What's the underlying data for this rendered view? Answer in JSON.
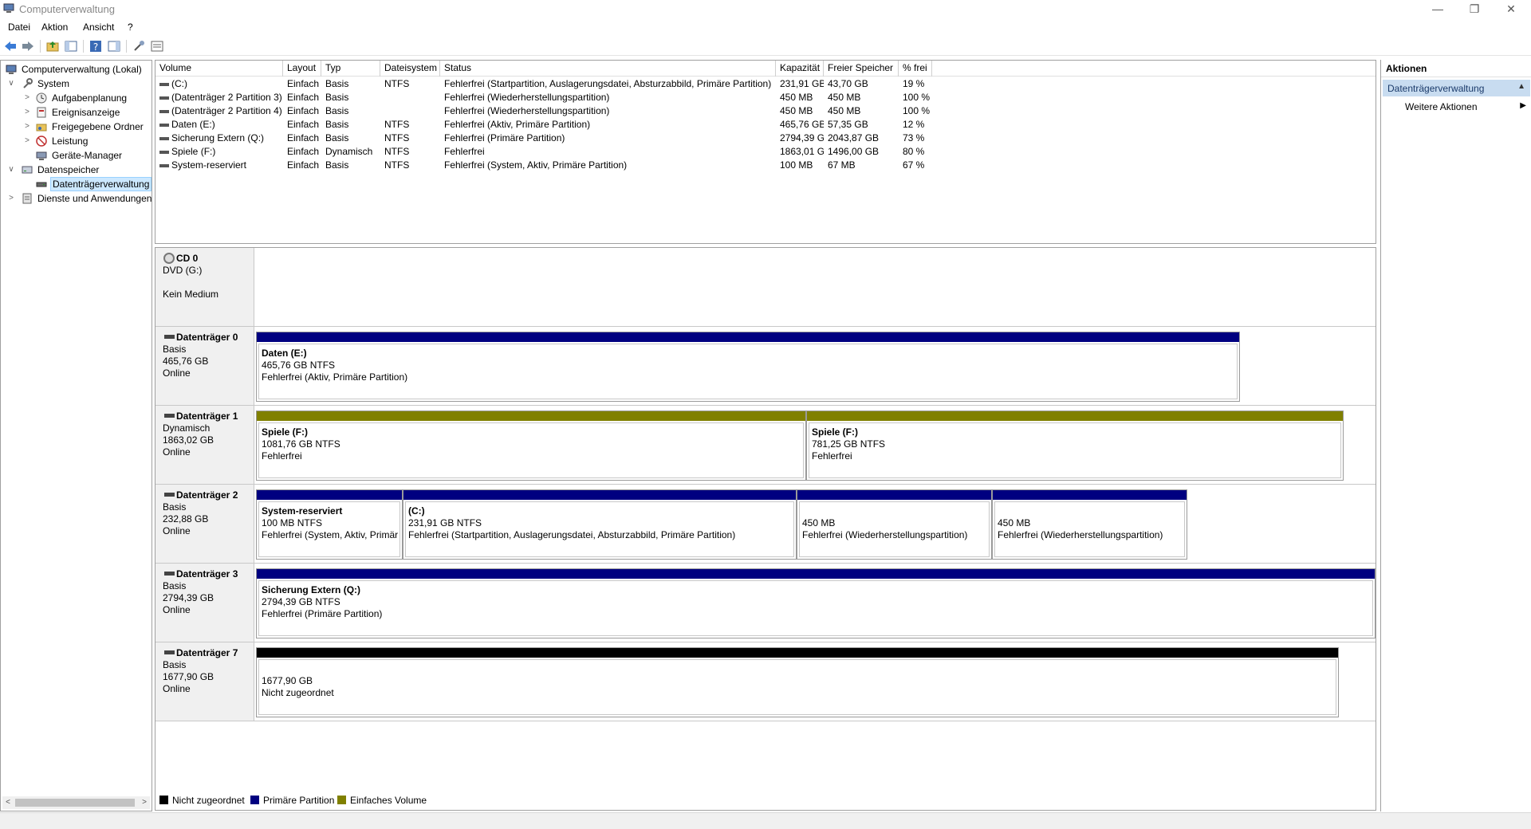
{
  "window": {
    "title": "Computerverwaltung"
  },
  "menu": {
    "items": [
      "Datei",
      "Aktion",
      "Ansicht",
      "?"
    ]
  },
  "tree": {
    "items": [
      {
        "label": "Computerverwaltung (Lokal)",
        "level": 0,
        "expander": "",
        "icon": "computer-management-icon"
      },
      {
        "label": "System",
        "level": 0,
        "expander": "v",
        "icon": "system-tools-icon"
      },
      {
        "label": "Aufgabenplanung",
        "level": 1,
        "expander": ">",
        "icon": "task-scheduler-icon"
      },
      {
        "label": "Ereignisanzeige",
        "level": 1,
        "expander": ">",
        "icon": "event-viewer-icon"
      },
      {
        "label": "Freigegebene Ordner",
        "level": 1,
        "expander": ">",
        "icon": "shared-folders-icon"
      },
      {
        "label": "Leistung",
        "level": 1,
        "expander": ">",
        "icon": "performance-icon"
      },
      {
        "label": "Geräte-Manager",
        "level": 1,
        "expander": "",
        "icon": "device-manager-icon"
      },
      {
        "label": "Datenspeicher",
        "level": 0,
        "expander": "v",
        "icon": "storage-icon"
      },
      {
        "label": "Datenträgerverwaltung",
        "level": 1,
        "expander": "",
        "icon": "disk-management-icon",
        "selected": true
      },
      {
        "label": "Dienste und Anwendungen",
        "level": 0,
        "expander": ">",
        "icon": "services-icon"
      }
    ]
  },
  "volumes": {
    "columns": [
      "Volume",
      "Layout",
      "Typ",
      "Dateisystem",
      "Status",
      "Kapazität",
      "Freier Speicher",
      "% frei"
    ],
    "rows": [
      [
        "(C:)",
        "Einfach",
        "Basis",
        "NTFS",
        "Fehlerfrei (Startpartition, Auslagerungsdatei, Absturzabbild, Primäre Partition)",
        "231,91 GB",
        "43,70 GB",
        "19 %"
      ],
      [
        "(Datenträger 2 Partition 3)",
        "Einfach",
        "Basis",
        "",
        "Fehlerfrei (Wiederherstellungspartition)",
        "450 MB",
        "450 MB",
        "100 %"
      ],
      [
        "(Datenträger 2 Partition 4)",
        "Einfach",
        "Basis",
        "",
        "Fehlerfrei (Wiederherstellungspartition)",
        "450 MB",
        "450 MB",
        "100 %"
      ],
      [
        "Daten (E:)",
        "Einfach",
        "Basis",
        "NTFS",
        "Fehlerfrei (Aktiv, Primäre Partition)",
        "465,76 GB",
        "57,35 GB",
        "12 %"
      ],
      [
        "Sicherung Extern (Q:)",
        "Einfach",
        "Basis",
        "NTFS",
        "Fehlerfrei (Primäre Partition)",
        "2794,39 GB",
        "2043,87 GB",
        "73 %"
      ],
      [
        "Spiele (F:)",
        "Einfach",
        "Dynamisch",
        "NTFS",
        "Fehlerfrei",
        "1863,01 GB",
        "1496,00 GB",
        "80 %"
      ],
      [
        "System-reserviert",
        "Einfach",
        "Basis",
        "NTFS",
        "Fehlerfrei (System, Aktiv, Primäre Partition)",
        "100 MB",
        "67 MB",
        "67 %"
      ]
    ]
  },
  "disks": [
    {
      "name": "CD 0",
      "kind": "cd",
      "lines": [
        "DVD (G:)",
        "",
        "Kein Medium"
      ],
      "partitions": []
    },
    {
      "name": "Datenträger 0",
      "kind": "disk",
      "lines": [
        "Basis",
        "465,76 GB",
        "Online"
      ],
      "partitions": [
        {
          "name": "Daten  (E:)",
          "size": "465,76 GB NTFS",
          "status": "Fehlerfrei (Aktiv, Primäre Partition)",
          "color": "#000080"
        }
      ]
    },
    {
      "name": "Datenträger 1",
      "kind": "disk",
      "lines": [
        "Dynamisch",
        "1863,02 GB",
        "Online"
      ],
      "partitions": [
        {
          "name": "Spiele  (F:)",
          "size": "1081,76 GB NTFS",
          "status": "Fehlerfrei",
          "color": "#808000"
        },
        {
          "name": "Spiele  (F:)",
          "size": "781,25 GB NTFS",
          "status": "Fehlerfrei",
          "color": "#808000"
        }
      ]
    },
    {
      "name": "Datenträger 2",
      "kind": "disk",
      "lines": [
        "Basis",
        "232,88 GB",
        "Online"
      ],
      "partitions": [
        {
          "name": "System-reserviert",
          "size": "100 MB NTFS",
          "status": "Fehlerfrei (System, Aktiv, Primär",
          "color": "#000080"
        },
        {
          "name": "(C:)",
          "size": "231,91 GB NTFS",
          "status": "Fehlerfrei (Startpartition, Auslagerungsdatei, Absturzabbild, Primäre Partition)",
          "color": "#000080"
        },
        {
          "name": "",
          "size": "450 MB",
          "status": "Fehlerfrei (Wiederherstellungspartition)",
          "color": "#000080"
        },
        {
          "name": "",
          "size": "450 MB",
          "status": "Fehlerfrei (Wiederherstellungspartition)",
          "color": "#000080"
        }
      ]
    },
    {
      "name": "Datenträger 3",
      "kind": "disk",
      "lines": [
        "Basis",
        "2794,39 GB",
        "Online"
      ],
      "partitions": [
        {
          "name": "Sicherung Extern  (Q:)",
          "size": "2794,39 GB NTFS",
          "status": "Fehlerfrei (Primäre Partition)",
          "color": "#000080"
        }
      ]
    },
    {
      "name": "Datenträger 7",
      "kind": "disk",
      "lines": [
        "Basis",
        "1677,90 GB",
        "Online"
      ],
      "partitions": [
        {
          "name": "",
          "size": "1677,90 GB",
          "status": "Nicht zugeordnet",
          "color": "#000000"
        }
      ]
    }
  ],
  "legend": [
    {
      "label": "Nicht zugeordnet",
      "color": "#000000"
    },
    {
      "label": "Primäre Partition",
      "color": "#000080"
    },
    {
      "label": "Einfaches Volume",
      "color": "#808000"
    }
  ],
  "actions": {
    "title": "Aktionen",
    "section": "Datenträgerverwaltung",
    "link": "Weitere Aktionen"
  }
}
